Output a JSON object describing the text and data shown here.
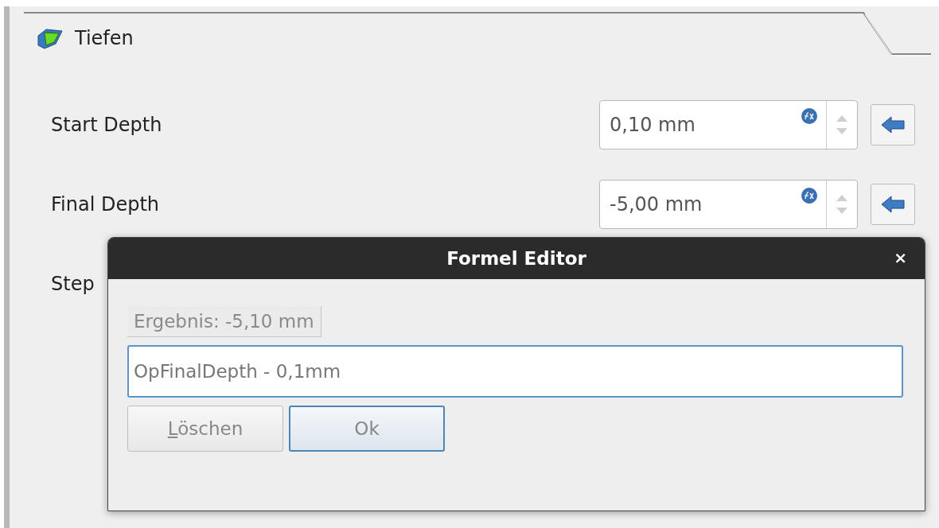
{
  "section": {
    "title": "Tiefen"
  },
  "fields": [
    {
      "label": "Start Depth",
      "value": "0,10 mm"
    },
    {
      "label": "Final Depth",
      "value": "-5,00 mm"
    },
    {
      "label": "Step"
    }
  ],
  "dialog": {
    "title": "Formel Editor",
    "close": "×",
    "result": "Ergebnis:  -5,10 mm",
    "expression": "OpFinalDepth - 0,1mm",
    "buttons": [
      {
        "label": "Löschen",
        "default": false
      },
      {
        "label": "Ok",
        "default": true
      }
    ]
  }
}
